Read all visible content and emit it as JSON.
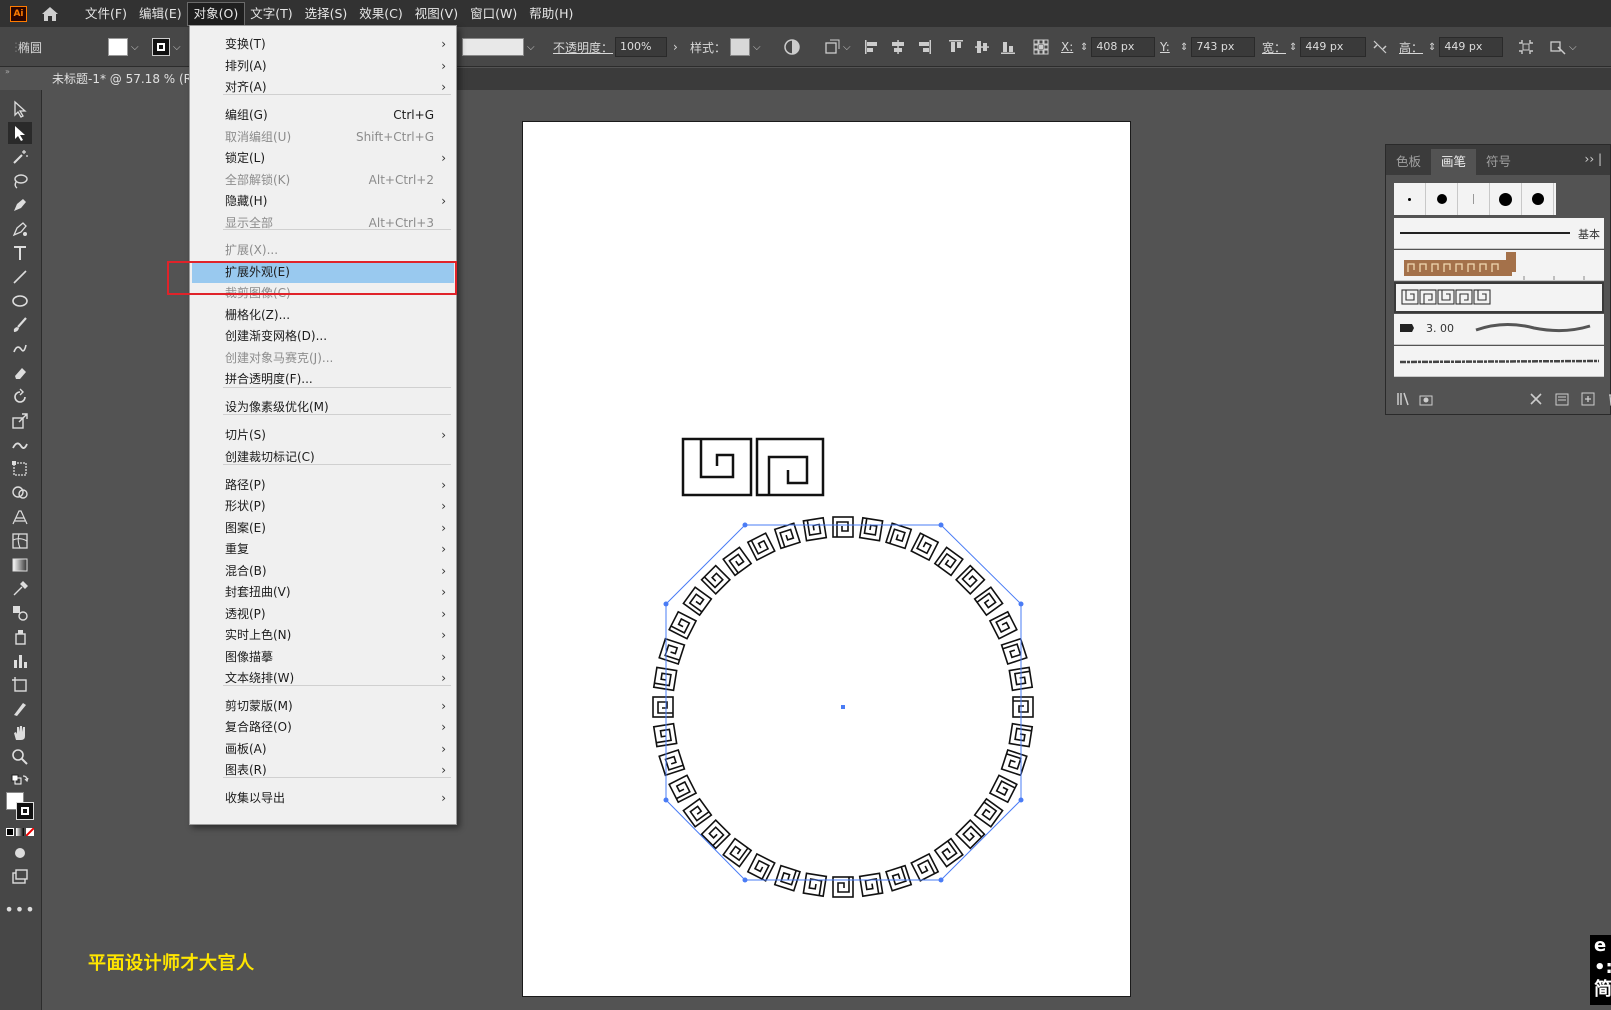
{
  "menubar": {
    "logo": "Ai",
    "items": [
      "文件(F)",
      "编辑(E)",
      "对象(O)",
      "文字(T)",
      "选择(S)",
      "效果(C)",
      "视图(V)",
      "窗口(W)",
      "帮助(H)"
    ],
    "active_index": 2
  },
  "control": {
    "object_type": "椭圆",
    "opacity_label": "不透明度：",
    "opacity_value": "100%",
    "style_label": "样式：",
    "x_label": "X:",
    "x_value": "408 px",
    "y_label": "Y:",
    "y_value": "743 px",
    "w_label": "宽：",
    "w_value": "449 px",
    "h_label": "高：",
    "h_value": "449 px"
  },
  "document": {
    "tab_title": "未标题-1* @ 57.18 % (R"
  },
  "object_menu": {
    "items": [
      {
        "label": "变换(T)",
        "shortcut": "",
        "submenu": true,
        "disabled": false
      },
      {
        "label": "排列(A)",
        "shortcut": "",
        "submenu": true,
        "disabled": false
      },
      {
        "label": "对齐(A)",
        "shortcut": "",
        "submenu": true,
        "disabled": false
      },
      {
        "label": "编组(G)",
        "shortcut": "Ctrl+G",
        "submenu": false,
        "disabled": false
      },
      {
        "label": "取消编组(U)",
        "shortcut": "Shift+Ctrl+G",
        "submenu": false,
        "disabled": true
      },
      {
        "label": "锁定(L)",
        "shortcut": "",
        "submenu": true,
        "disabled": false
      },
      {
        "label": "全部解锁(K)",
        "shortcut": "Alt+Ctrl+2",
        "submenu": false,
        "disabled": true
      },
      {
        "label": "隐藏(H)",
        "shortcut": "",
        "submenu": true,
        "disabled": false
      },
      {
        "label": "显示全部",
        "shortcut": "Alt+Ctrl+3",
        "submenu": false,
        "disabled": true
      },
      {
        "label": "扩展(X)...",
        "shortcut": "",
        "submenu": false,
        "disabled": true
      },
      {
        "label": "扩展外观(E)",
        "shortcut": "",
        "submenu": false,
        "disabled": false,
        "highlighted": true
      },
      {
        "label": "裁剪图像(C)",
        "shortcut": "",
        "submenu": false,
        "disabled": true
      },
      {
        "label": "栅格化(Z)...",
        "shortcut": "",
        "submenu": false,
        "disabled": false
      },
      {
        "label": "创建渐变网格(D)...",
        "shortcut": "",
        "submenu": false,
        "disabled": false
      },
      {
        "label": "创建对象马赛克(J)...",
        "shortcut": "",
        "submenu": false,
        "disabled": true
      },
      {
        "label": "拼合透明度(F)...",
        "shortcut": "",
        "submenu": false,
        "disabled": false
      },
      {
        "label": "设为像素级优化(M)",
        "shortcut": "",
        "submenu": false,
        "disabled": false
      },
      {
        "label": "切片(S)",
        "shortcut": "",
        "submenu": true,
        "disabled": false
      },
      {
        "label": "创建裁切标记(C)",
        "shortcut": "",
        "submenu": false,
        "disabled": false
      },
      {
        "label": "路径(P)",
        "shortcut": "",
        "submenu": true,
        "disabled": false
      },
      {
        "label": "形状(P)",
        "shortcut": "",
        "submenu": true,
        "disabled": false
      },
      {
        "label": "图案(E)",
        "shortcut": "",
        "submenu": true,
        "disabled": false
      },
      {
        "label": "重复",
        "shortcut": "",
        "submenu": true,
        "disabled": false
      },
      {
        "label": "混合(B)",
        "shortcut": "",
        "submenu": true,
        "disabled": false
      },
      {
        "label": "封套扭曲(V)",
        "shortcut": "",
        "submenu": true,
        "disabled": false
      },
      {
        "label": "透视(P)",
        "shortcut": "",
        "submenu": true,
        "disabled": false
      },
      {
        "label": "实时上色(N)",
        "shortcut": "",
        "submenu": true,
        "disabled": false
      },
      {
        "label": "图像描摹",
        "shortcut": "",
        "submenu": true,
        "disabled": false
      },
      {
        "label": "文本绕排(W)",
        "shortcut": "",
        "submenu": true,
        "disabled": false
      },
      {
        "label": "剪切蒙版(M)",
        "shortcut": "",
        "submenu": true,
        "disabled": false
      },
      {
        "label": "复合路径(O)",
        "shortcut": "",
        "submenu": true,
        "disabled": false
      },
      {
        "label": "画板(A)",
        "shortcut": "",
        "submenu": true,
        "disabled": false
      },
      {
        "label": "图表(R)",
        "shortcut": "",
        "submenu": true,
        "disabled": false
      },
      {
        "label": "收集以导出",
        "shortcut": "",
        "submenu": true,
        "disabled": false
      }
    ]
  },
  "brush_panel": {
    "tabs": [
      "色板",
      "画笔",
      "符号"
    ],
    "active_tab": 1,
    "basic_label": "基本",
    "stroke_value": "3. 00"
  },
  "watermark": "平面设计师才大官人",
  "corner_text": "e\n•:\n简",
  "colors": {
    "accent": "#4a7cf5",
    "highlight": "#99c9ef",
    "watermark": "#ffe600",
    "annotation": "#e0232a"
  }
}
